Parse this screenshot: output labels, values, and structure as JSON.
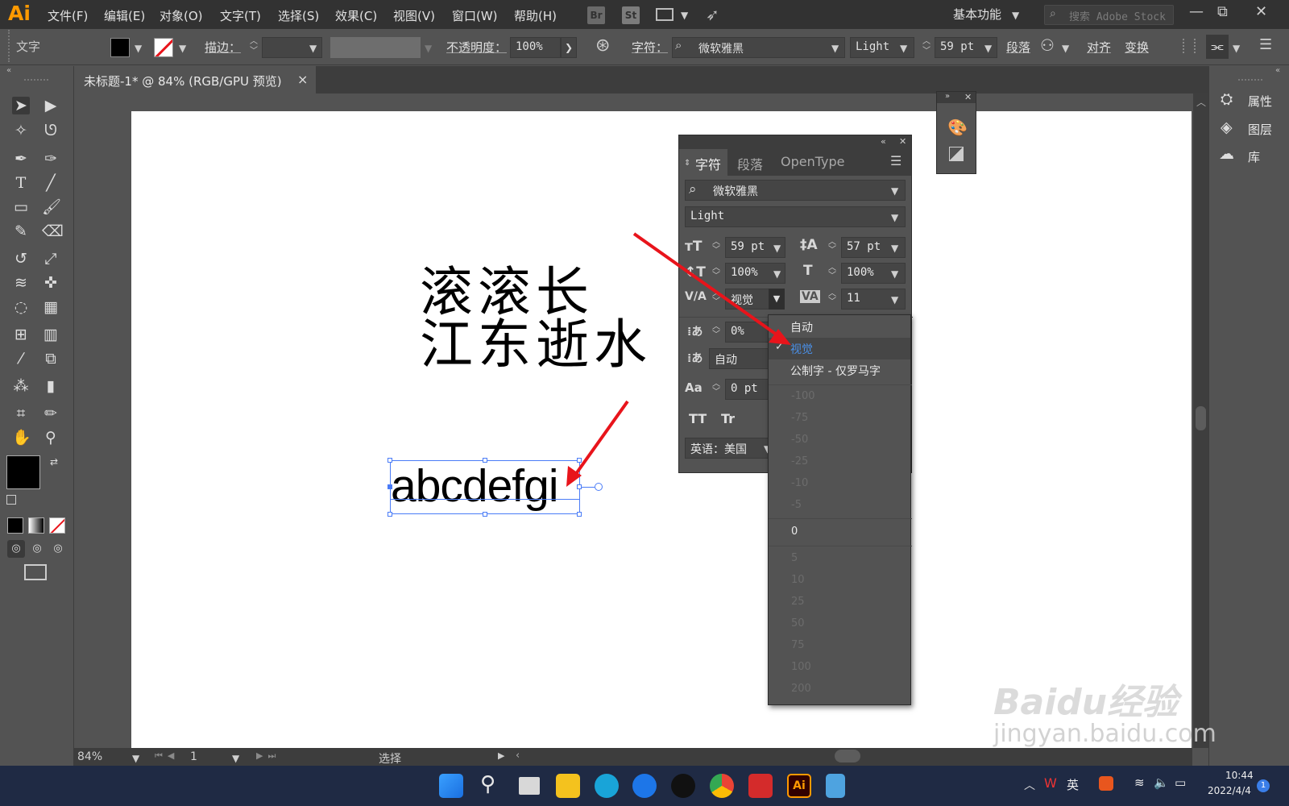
{
  "app": {
    "logo": "Ai"
  },
  "menu": [
    "文件(F)",
    "编辑(E)",
    "对象(O)",
    "文字(T)",
    "选择(S)",
    "效果(C)",
    "视图(V)",
    "窗口(W)",
    "帮助(H)"
  ],
  "menubar": {
    "br_label": "Br",
    "st_label": "St",
    "workspace": "基本功能",
    "search_placeholder": "搜索 Adobe Stock",
    "win_min": "—",
    "win_restore": "⧉",
    "win_close": "✕"
  },
  "control_bar": {
    "selection_label": "文字",
    "stroke_label": "描边：",
    "opacity_label": "不透明度：",
    "opacity_value": "100%",
    "character_label": "字符：",
    "font_family": "微软雅黑",
    "font_style": "Light",
    "font_size": "59 pt",
    "paragraph_label": "段落",
    "align_label": "对齐",
    "transform_label": "变换"
  },
  "document_tab": {
    "title": "未标题-1* @ 84% (RGB/GPU 预览)",
    "close": "×"
  },
  "canvas": {
    "chinese_line1": "滚滚长",
    "chinese_line2": "江东逝水",
    "latin_text": "abcdefgi"
  },
  "right_panel": {
    "items": [
      "属性",
      "图层",
      "库"
    ]
  },
  "character_panel": {
    "tabs": [
      "字符",
      "段落",
      "OpenType"
    ],
    "font_family": "微软雅黑",
    "font_style": "Light",
    "font_size": "59 pt",
    "leading": "57 pt",
    "vertical_scale": "100%",
    "horizontal_scale": "100%",
    "kerning": "视觉",
    "tracking": "11",
    "tsume": "0%",
    "auto": "自动",
    "baseline_shift": "0 pt",
    "tt_all_caps": "TT",
    "tt_small_caps": "Tr",
    "language": "英语：美国"
  },
  "kerning_dropdown": {
    "options": [
      "自动",
      "视觉",
      "公制字 - 仅罗马字"
    ],
    "selected": "视觉",
    "negative_values": [
      "-100",
      "-75",
      "-50",
      "-25",
      "-10",
      "-5"
    ],
    "zero_value": "0",
    "positive_values": [
      "5",
      "10",
      "25",
      "50",
      "75",
      "100",
      "200"
    ]
  },
  "status_bar": {
    "zoom": "84%",
    "artboard": "1",
    "tool": "选择"
  },
  "taskbar": {
    "ime": "英",
    "time": "10:44",
    "date": "2022/4/4",
    "notification_count": "1"
  },
  "watermark": {
    "text": "Baidu经验",
    "url": "jingyan.baidu.com"
  },
  "colors": {
    "accent_arrow": "#e8141b",
    "selection_blue": "#4a7cf7",
    "app_bg": "#535353",
    "menubar_bg": "#323232"
  }
}
